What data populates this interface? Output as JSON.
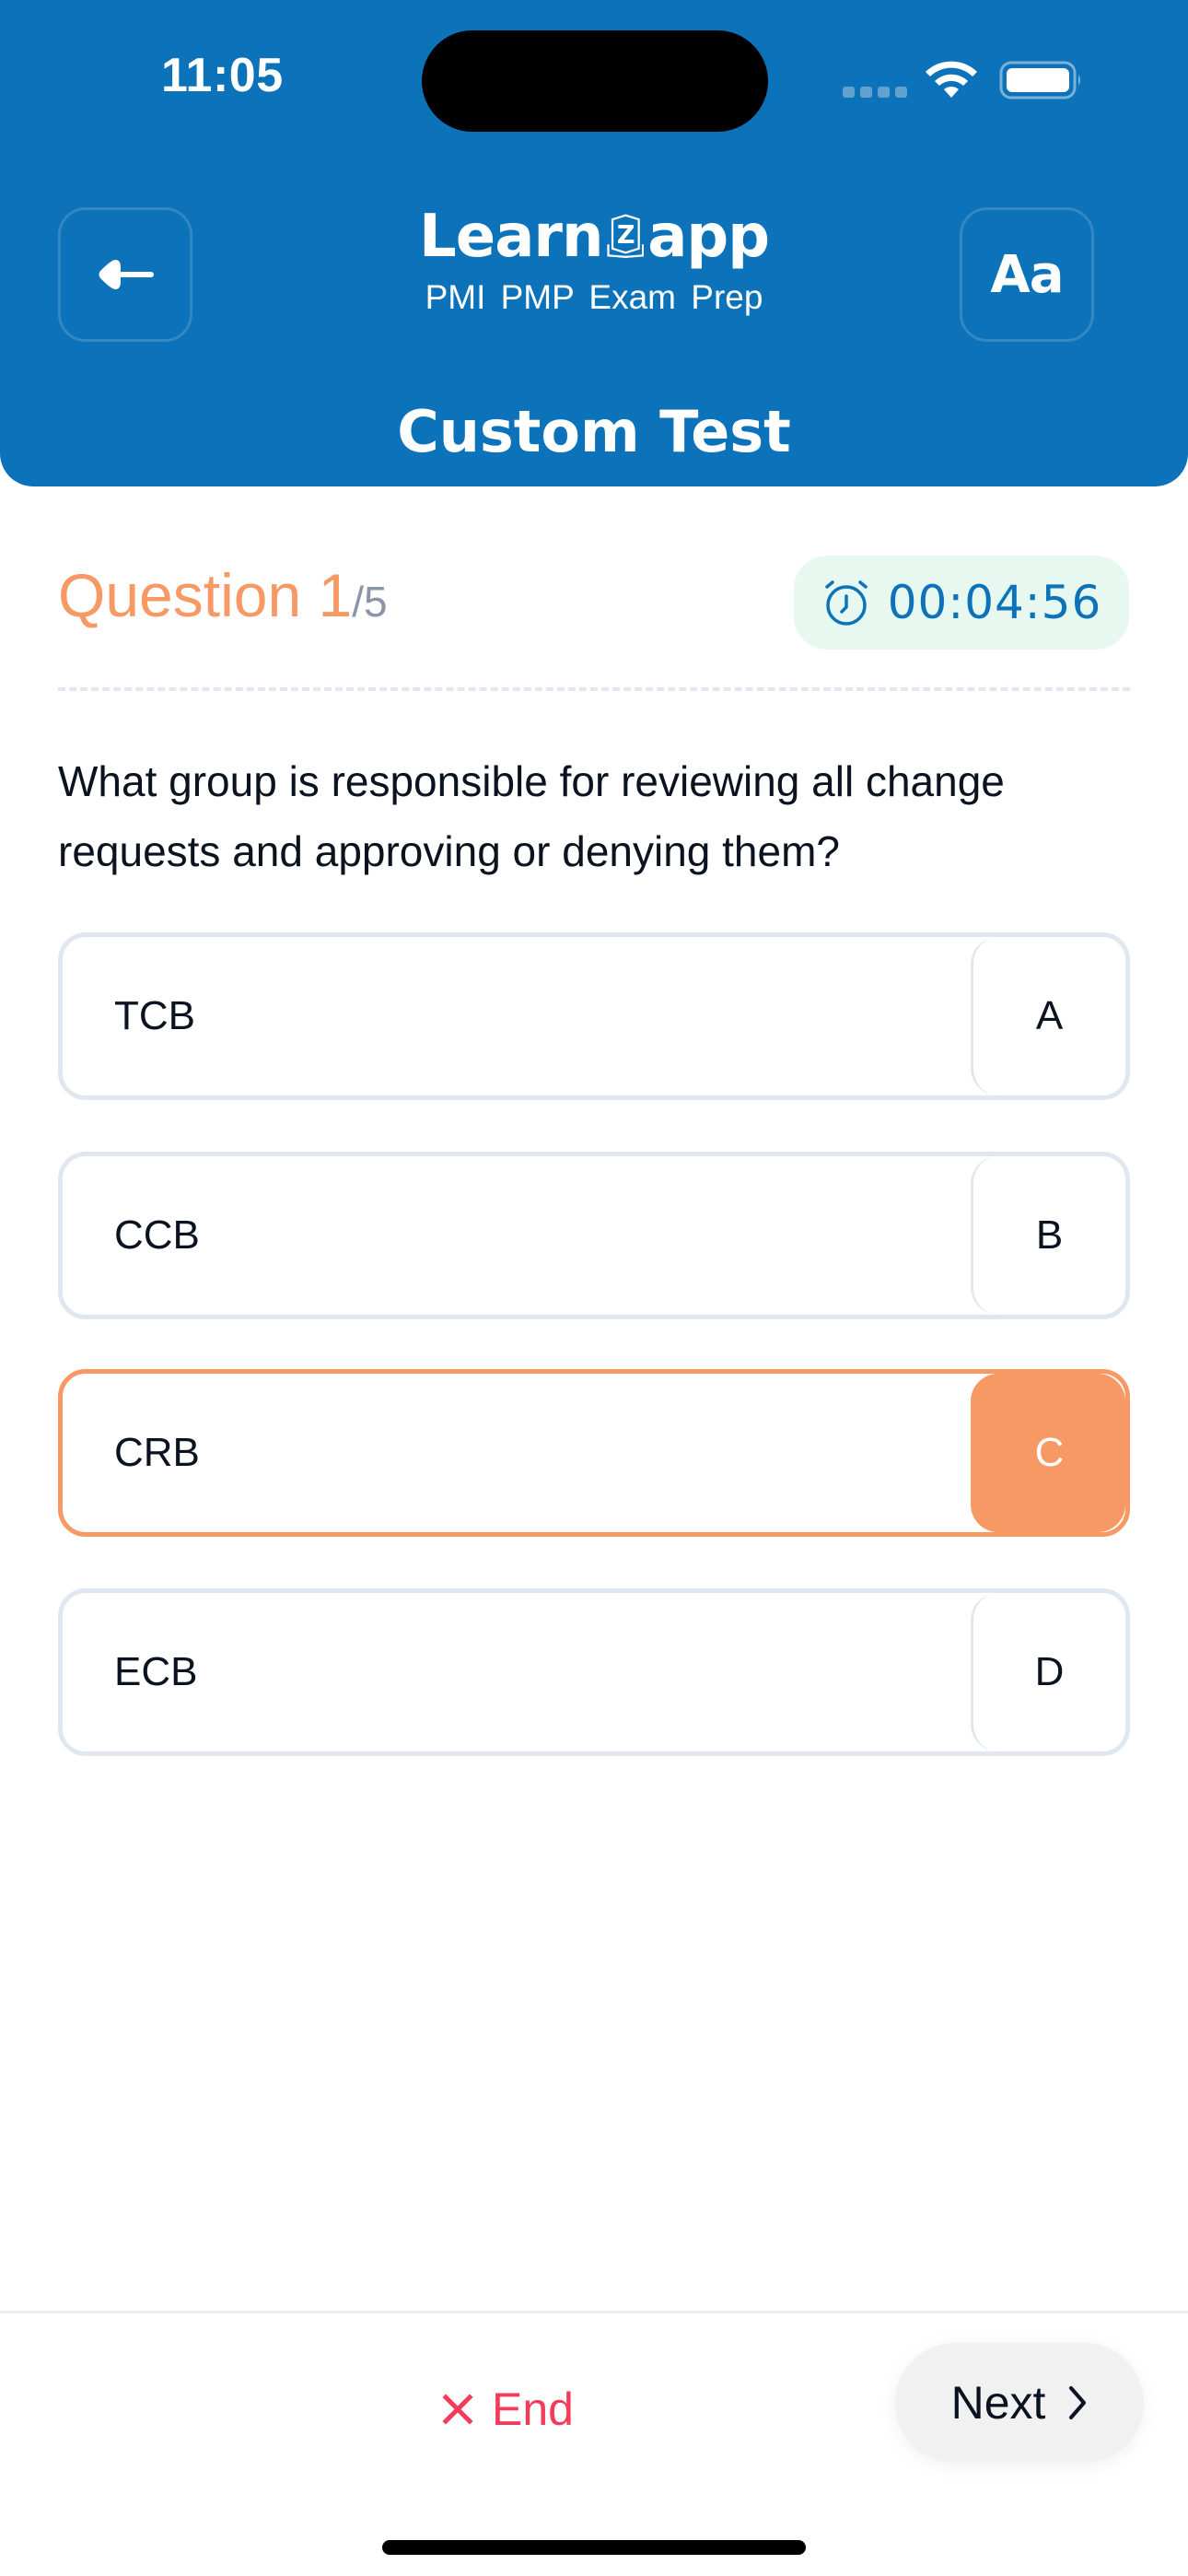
{
  "status_bar": {
    "time": "11:05",
    "wifi_icon": "wifi-icon",
    "battery_icon": "battery-icon"
  },
  "header": {
    "back_icon": "arrow-left-icon",
    "logo_text_left": "Learn",
    "logo_text_right": "app",
    "logo_mark": "Z",
    "subtitle": "PMI  PMP  Exam Prep",
    "font_button_label": "Aa",
    "title": "Custom Test"
  },
  "question": {
    "label": "Question 1",
    "total": "/5",
    "current_number": 1,
    "total_count": 5,
    "timer_icon": "alarm-clock-icon",
    "timer": "00:04:56",
    "text": "What group is responsible for reviewing all change requests and approving or denying them?"
  },
  "options": [
    {
      "text": "TCB",
      "letter": "A",
      "selected": false
    },
    {
      "text": "CCB",
      "letter": "B",
      "selected": false
    },
    {
      "text": "CRB",
      "letter": "C",
      "selected": true
    },
    {
      "text": "ECB",
      "letter": "D",
      "selected": false
    }
  ],
  "footer": {
    "end_label": "End",
    "end_icon": "close-icon",
    "next_label": "Next",
    "next_icon": "chevron-right-icon"
  },
  "colors": {
    "header_bg": "#0c72b9",
    "accent_orange": "#f79965",
    "timer_bg": "#e6f8f0",
    "timer_text": "#0c72b9",
    "end_red": "#f23c5a",
    "option_border": "#e1e7f1"
  }
}
